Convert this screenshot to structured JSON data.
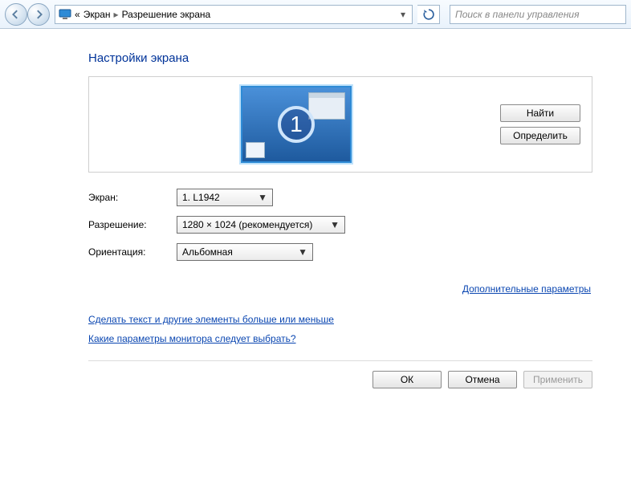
{
  "nav": {
    "back_aria": "Назад",
    "forward_aria": "Вперёд"
  },
  "breadcrumb": {
    "root_marker": "«",
    "item1": "Экран",
    "item2": "Разрешение экрана"
  },
  "search": {
    "placeholder": "Поиск в панели управления"
  },
  "title": "Настройки экрана",
  "preview": {
    "monitor_number": "1",
    "find_button": "Найти",
    "identify_button": "Определить"
  },
  "form": {
    "screen_label": "Экран:",
    "screen_value": "1. L1942",
    "resolution_label": "Разрешение:",
    "resolution_value": "1280 × 1024 (рекомендуется)",
    "orientation_label": "Ориентация:",
    "orientation_value": "Альбомная"
  },
  "links": {
    "advanced": "Дополнительные параметры",
    "text_size": "Сделать текст и другие элементы больше или меньше",
    "which_settings": "Какие параметры монитора следует выбрать?"
  },
  "footer": {
    "ok": "ОК",
    "cancel": "Отмена",
    "apply": "Применить"
  }
}
